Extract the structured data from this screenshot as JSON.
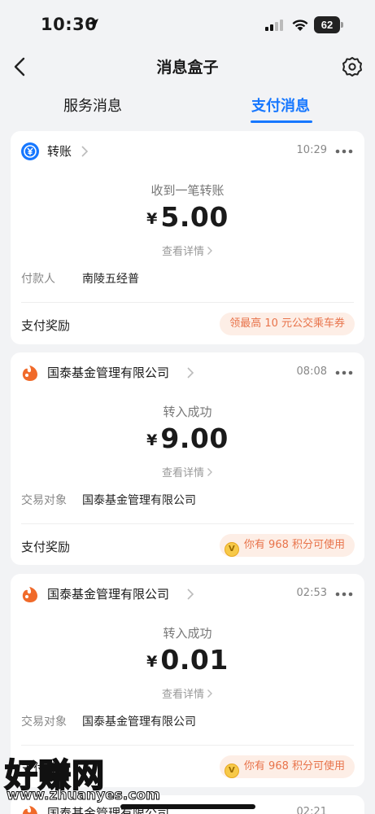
{
  "status_bar": {
    "time": "10:30",
    "battery": "62",
    "icons": [
      "location-arrow-icon",
      "signal-icon",
      "wifi-icon",
      "battery-icon"
    ]
  },
  "nav": {
    "title": "消息盒子",
    "icons": [
      "back-arrow-icon",
      "settings-gear-icon"
    ]
  },
  "tabs": [
    {
      "label": "服务消息",
      "active": false
    },
    {
      "label": "支付消息",
      "active": true
    }
  ],
  "colors": {
    "accent": "#1677ff",
    "reward_text": "#e8734a",
    "reward_bg": "#fdeee6"
  },
  "cards": [
    {
      "sender": "转账",
      "logo": "transfer-yuan-icon",
      "time": "10:29",
      "subtitle": "收到一笔转账",
      "currency": "¥",
      "amount": "5.00",
      "details": "查看详情",
      "field_label": "付款人",
      "field_value": "南陵五经普",
      "reward_label": "支付奖励",
      "reward_text": "领最高 10 元公交乘车券"
    },
    {
      "sender": "国泰基金管理有限公司",
      "logo": "guotai-fund-logo-icon",
      "time": "08:08",
      "subtitle": "转入成功",
      "currency": "¥",
      "amount": "9.00",
      "details": "查看详情",
      "field_label": "交易对象",
      "field_value": "国泰基金管理有限公司",
      "reward_label": "支付奖励",
      "reward_text": "你有 968 积分可使用"
    },
    {
      "sender": "国泰基金管理有限公司",
      "logo": "guotai-fund-logo-icon",
      "time": "02:53",
      "subtitle": "转入成功",
      "currency": "¥",
      "amount": "0.01",
      "details": "查看详情",
      "field_label": "交易对象",
      "field_value": "国泰基金管理有限公司",
      "reward_label": "支付奖励",
      "reward_text": "你有 968 积分可使用"
    },
    {
      "sender": "国泰基金管理有限公司",
      "logo": "guotai-fund-logo-icon",
      "time": "02:21"
    }
  ],
  "watermark": {
    "text": "好赚网",
    "url": "www.zhuanyes.com"
  }
}
